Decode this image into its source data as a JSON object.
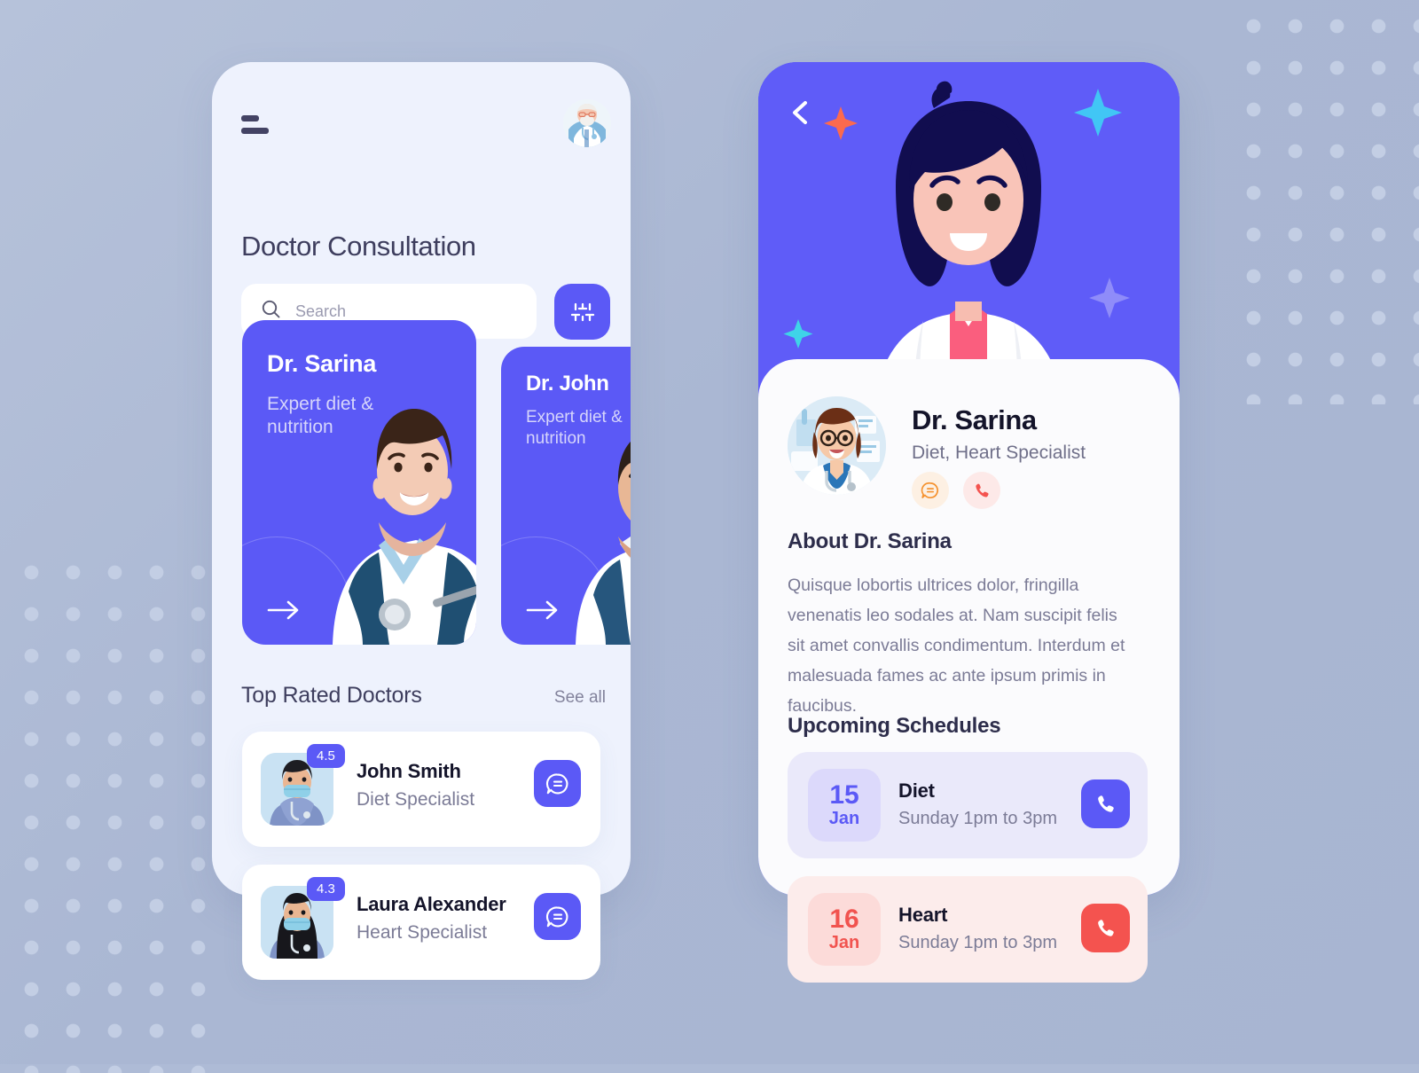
{
  "theme": {
    "primary": "#5b59f6",
    "danger": "#f4534f",
    "accent_orange": "#f58a2a",
    "page_bg": "#aebbd6",
    "phone_bg": "#eef2fd"
  },
  "left_screen": {
    "menu_icon": "hamburger-icon",
    "avatar_icon": "user-avatar-doctor",
    "title": "Doctor Consultation",
    "search": {
      "placeholder": "Search",
      "value": "",
      "icon": "search-icon"
    },
    "filter_icon": "sliders-filter-icon",
    "promo_cards": [
      {
        "name": "Dr. Sarina",
        "description": "Expert diet & nutrition",
        "cta_icon": "arrow-right-icon"
      },
      {
        "name": "Dr. John",
        "description": "Expert diet & nutrition",
        "cta_icon": "arrow-right-icon"
      }
    ],
    "top_rated": {
      "title": "Top Rated Doctors",
      "see_all": "See all",
      "doctors": [
        {
          "rating": "4.5",
          "name": "John Smith",
          "specialty": "Diet Specialist",
          "action_icon": "chat-bubble-icon"
        },
        {
          "rating": "4.3",
          "name": "Laura Alexander",
          "specialty": "Heart Specialist",
          "action_icon": "chat-bubble-icon"
        }
      ]
    }
  },
  "right_screen": {
    "back_icon": "chevron-left-icon",
    "hero_illustration": "female-doctor-illustration",
    "doctor": {
      "avatar_icon": "female-doctor-avatar",
      "name": "Dr. Sarina",
      "specialty": "Diet, Heart Specialist",
      "actions": [
        {
          "icon": "chat-bubble-icon",
          "name": "message"
        },
        {
          "icon": "phone-icon",
          "name": "call"
        }
      ]
    },
    "about": {
      "title": "About Dr. Sarina",
      "body": "Quisque lobortis ultrices dolor, fringilla venenatis leo sodales at. Nam suscipit felis sit amet convallis condimentum. Interdum et malesuada fames ac ante ipsum primis in faucibus."
    },
    "schedules": {
      "title": "Upcoming Schedules",
      "items": [
        {
          "day": "15",
          "month": "Jan",
          "title": "Diet",
          "time": "Sunday 1pm to 3pm",
          "action_icon": "phone-icon"
        },
        {
          "day": "16",
          "month": "Jan",
          "title": "Heart",
          "time": "Sunday 1pm to 3pm",
          "action_icon": "phone-icon"
        }
      ]
    }
  }
}
